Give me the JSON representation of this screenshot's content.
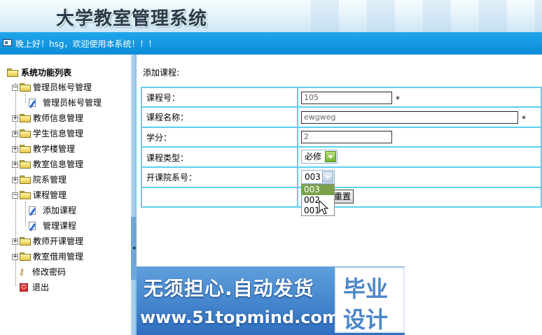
{
  "header": {
    "app_title": "大学教室管理系统",
    "greeting": "晚上好！hsg，欢迎使用本系统！！！"
  },
  "sidebar": {
    "root_label": "系统功能列表",
    "items": [
      {
        "label": "管理员帐号管理",
        "expanded": true,
        "toggle": "−"
      },
      {
        "label": "管理员帐号管理",
        "icon": "edit-page-icon"
      },
      {
        "label": "教师信息管理",
        "expanded": false,
        "toggle": "+"
      },
      {
        "label": "学生信息管理",
        "expanded": false,
        "toggle": "+"
      },
      {
        "label": "教学楼管理",
        "expanded": false,
        "toggle": "+"
      },
      {
        "label": "教室信息管理",
        "expanded": false,
        "toggle": "+"
      },
      {
        "label": "院系管理",
        "expanded": false,
        "toggle": "+"
      },
      {
        "label": "课程管理",
        "expanded": true,
        "toggle": "−"
      },
      {
        "label": "添加课程",
        "icon": "edit-page-icon"
      },
      {
        "label": "管理课程",
        "icon": "edit-page-icon"
      },
      {
        "label": "教师开课管理",
        "expanded": false,
        "toggle": "+"
      },
      {
        "label": "教室借用管理",
        "expanded": false,
        "toggle": "+"
      },
      {
        "label": "修改密码",
        "icon": "key-icon"
      },
      {
        "label": "退出",
        "icon": "power-icon"
      }
    ]
  },
  "form": {
    "title": "添加课程:",
    "course_no_label": "课程号：",
    "course_no_value": "105",
    "course_name_label": "课程名称：",
    "course_name_value": "ewgweg",
    "credit_label": "学分：",
    "credit_value": "2",
    "course_type_label": "课程类型：",
    "course_type_value": "必修",
    "dept_label": "开课院系号：",
    "dept_value": "003",
    "dept_options": [
      "003",
      "002",
      "001"
    ],
    "required_mark": "*",
    "reset_label": "重置"
  },
  "watermark": {
    "line1": "无须担心.自动发货",
    "line2": "www.51topmind.com",
    "box_line1": "毕业",
    "box_line2": "设计"
  },
  "colors": {
    "greeting_bar": "#0b8bd8",
    "table_border": "#5bd0ec",
    "dropdown_selected": "#7aa14a",
    "watermark_bg": "#2f6fbf"
  }
}
